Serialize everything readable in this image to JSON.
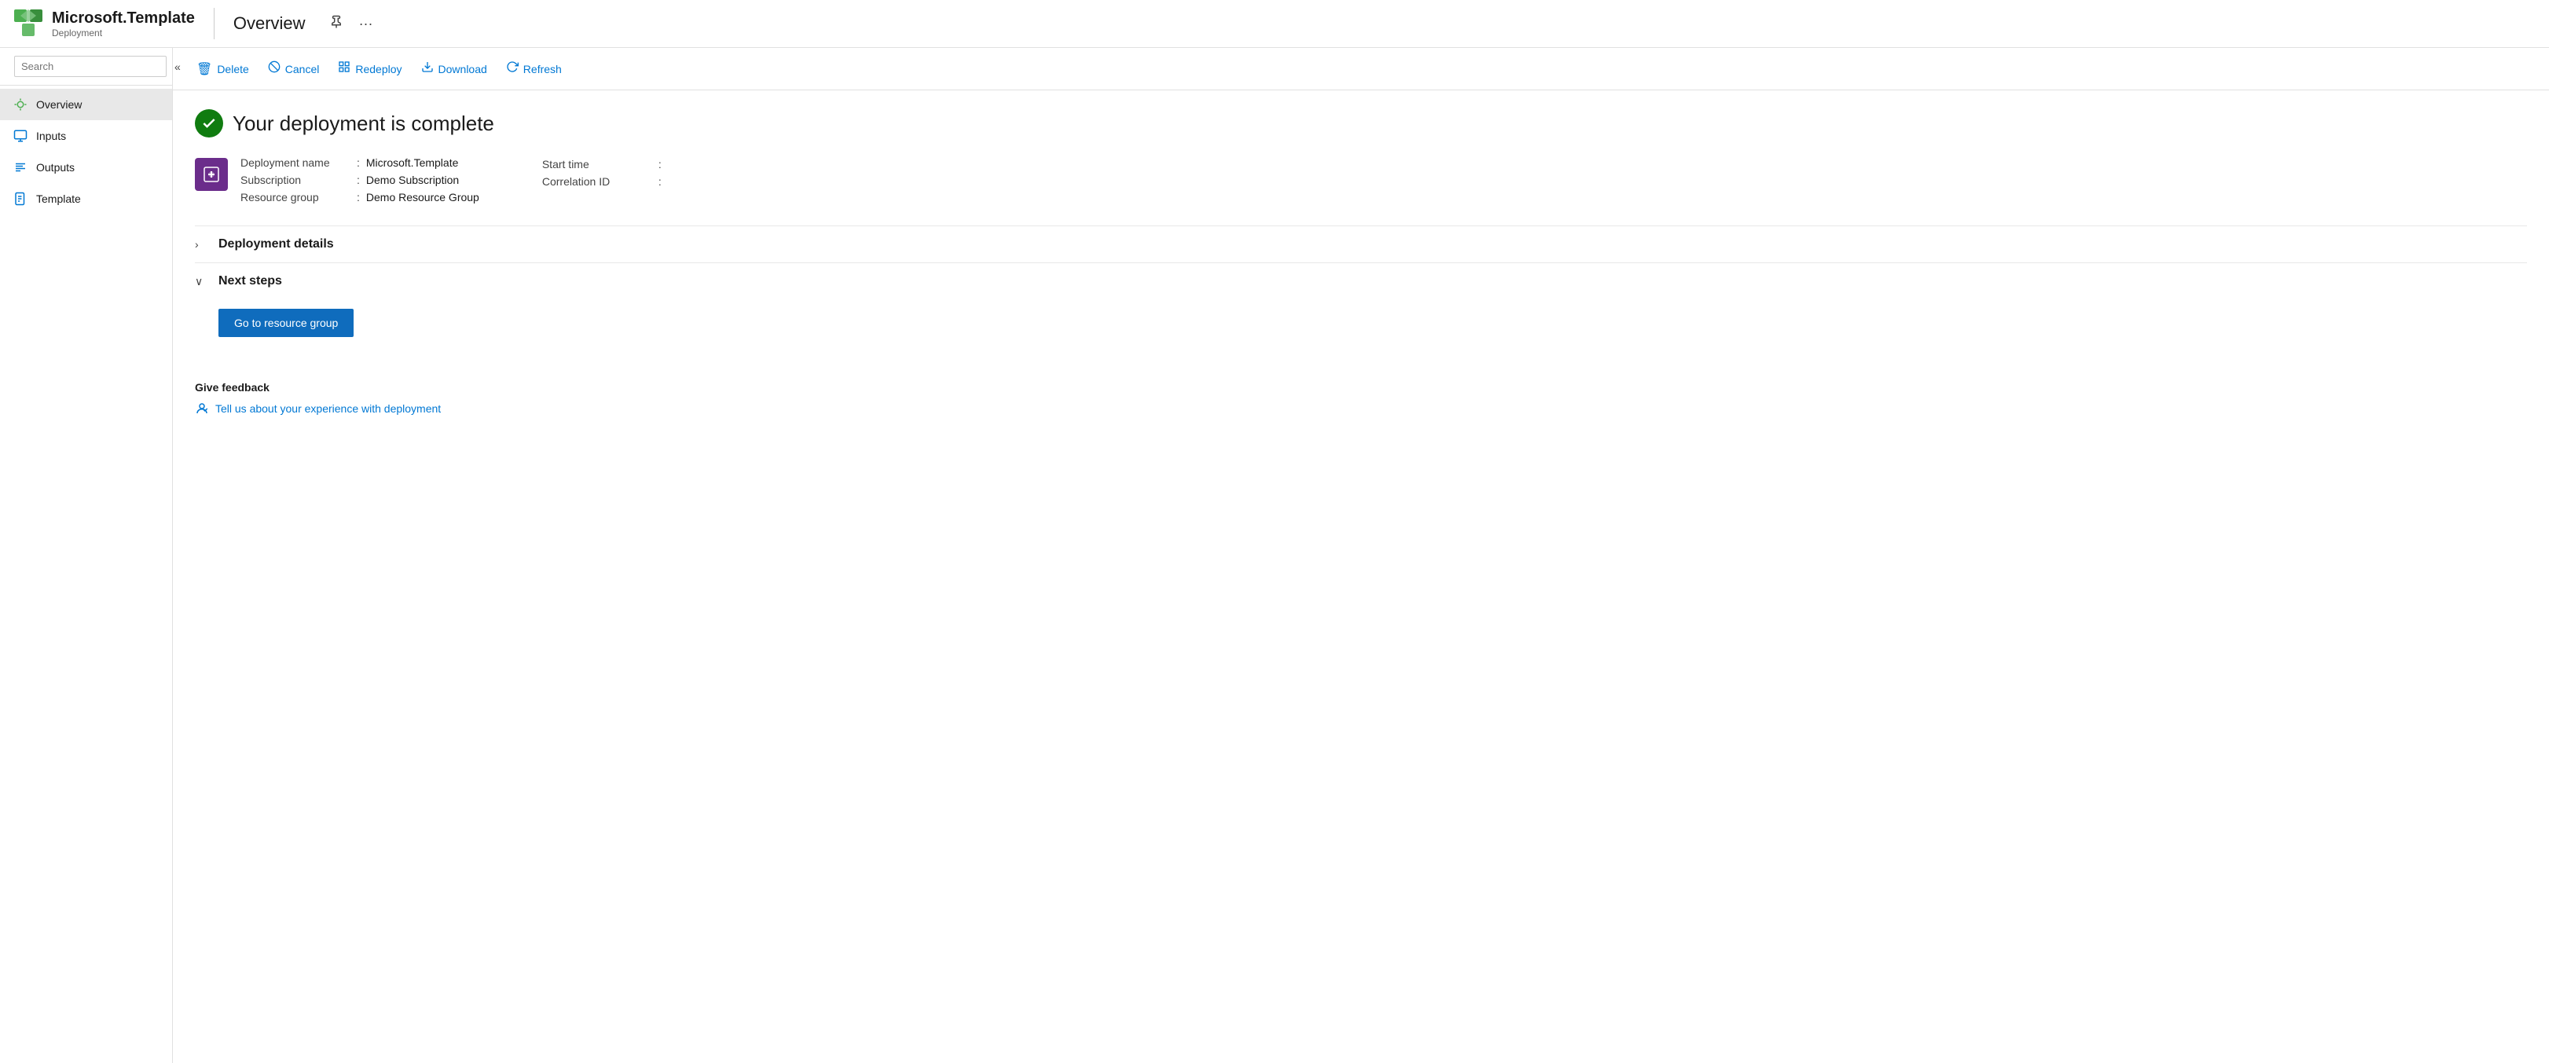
{
  "header": {
    "app_name": "Microsoft.Template",
    "subtitle": "Deployment",
    "divider": true,
    "page_title": "Overview",
    "pin_icon": "📌",
    "more_icon": "···"
  },
  "sidebar": {
    "search_placeholder": "Search",
    "collapse_icon": "«",
    "nav_items": [
      {
        "id": "overview",
        "label": "Overview",
        "icon": "overview",
        "active": true
      },
      {
        "id": "inputs",
        "label": "Inputs",
        "icon": "inputs",
        "active": false
      },
      {
        "id": "outputs",
        "label": "Outputs",
        "icon": "outputs",
        "active": false
      },
      {
        "id": "template",
        "label": "Template",
        "icon": "template",
        "active": false
      }
    ]
  },
  "toolbar": {
    "buttons": [
      {
        "id": "delete",
        "label": "Delete",
        "icon": "🗑"
      },
      {
        "id": "cancel",
        "label": "Cancel",
        "icon": "⊘"
      },
      {
        "id": "redeploy",
        "label": "Redeploy",
        "icon": "⊞"
      },
      {
        "id": "download",
        "label": "Download",
        "icon": "⬇"
      },
      {
        "id": "refresh",
        "label": "Refresh",
        "icon": "↺"
      }
    ]
  },
  "main": {
    "deployment_complete_title": "Your deployment is complete",
    "deployment_info": {
      "name_label": "Deployment name",
      "name_value": "Microsoft.Template",
      "subscription_label": "Subscription",
      "subscription_value": "Demo Subscription",
      "resource_group_label": "Resource group",
      "resource_group_value": "Demo Resource Group",
      "start_time_label": "Start time",
      "start_time_value": "",
      "correlation_id_label": "Correlation ID",
      "correlation_id_value": ""
    },
    "sections": [
      {
        "id": "deployment-details",
        "label": "Deployment details",
        "expanded": false,
        "chevron": "›"
      },
      {
        "id": "next-steps",
        "label": "Next steps",
        "expanded": true,
        "chevron": "∨"
      }
    ],
    "go_to_resource_group_label": "Go to resource group",
    "feedback": {
      "title": "Give feedback",
      "link_text": "Tell us about your experience with deployment"
    }
  }
}
